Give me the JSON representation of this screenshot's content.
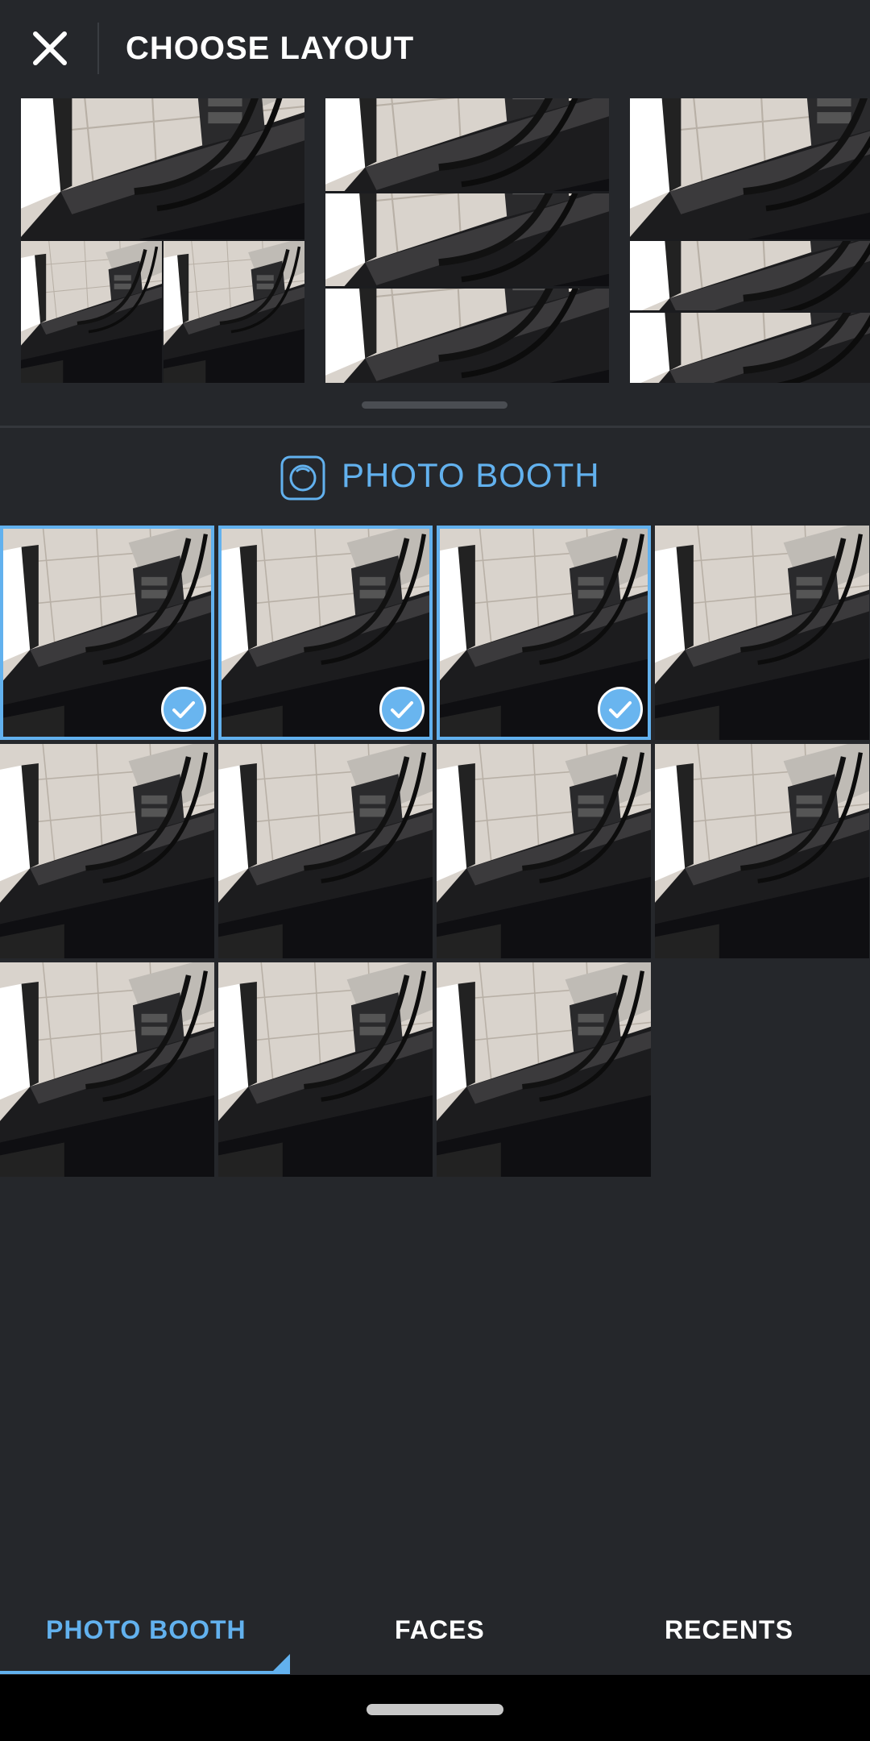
{
  "header": {
    "title": "CHOOSE LAYOUT",
    "close_icon": "close-icon"
  },
  "layout_options": [
    {
      "name": "layout-1-top-2-bottom",
      "selected": false
    },
    {
      "name": "layout-3-rows",
      "selected": false
    },
    {
      "name": "layout-1-top-2-rows",
      "selected": false
    }
  ],
  "section": {
    "icon": "photo-booth-icon",
    "title": "PHOTO BOOTH"
  },
  "photos": [
    {
      "selected": true
    },
    {
      "selected": true
    },
    {
      "selected": true
    },
    {
      "selected": false
    },
    {
      "selected": false
    },
    {
      "selected": false
    },
    {
      "selected": false
    },
    {
      "selected": false
    },
    {
      "selected": false
    },
    {
      "selected": false
    },
    {
      "selected": false
    }
  ],
  "tabs": [
    {
      "label": "PHOTO BOOTH",
      "active": true
    },
    {
      "label": "FACES",
      "active": false
    },
    {
      "label": "RECENTS",
      "active": false
    }
  ],
  "colors": {
    "background": "#25272b",
    "accent": "#62b1ee",
    "text": "#ffffff"
  }
}
